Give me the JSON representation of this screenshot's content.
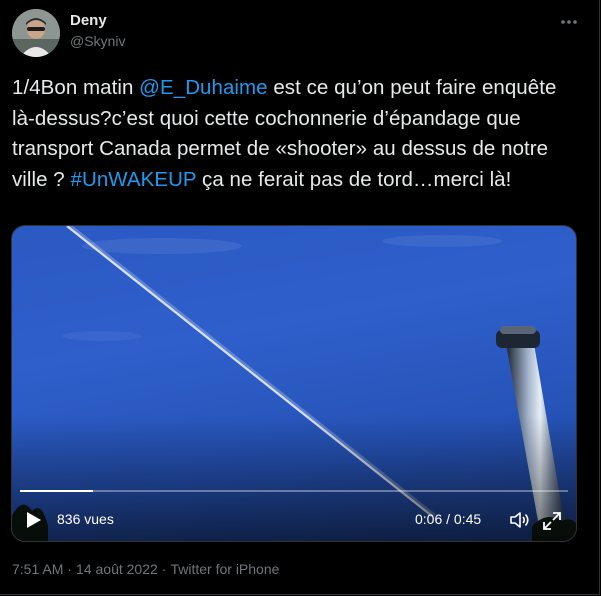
{
  "author": {
    "name": "Deny",
    "handle": "@Skyniv"
  },
  "tweet": {
    "text_parts": [
      {
        "text": "1/4Bon matin ",
        "type": "text"
      },
      {
        "text": "@E_Duhaime",
        "type": "mention"
      },
      {
        "text": " est ce qu’on peut faire enquête là-dessus?c’est quoi cette cochonnerie d’épandage que transport Canada permet de «shooter» au dessus de notre ville ? ",
        "type": "text"
      },
      {
        "text": "#UnWAKEUP",
        "type": "hashtag"
      },
      {
        "text": " ça ne ferait pas de tord…merci là!",
        "type": "text"
      }
    ]
  },
  "video": {
    "views": "836 vues",
    "time": "0:06 / 0:45",
    "progress": 0.133
  },
  "meta": {
    "time": "7:51 AM",
    "separator1": "·",
    "date": "14 août 2022",
    "separator2": "·",
    "source": "Twitter for iPhone"
  },
  "colors": {
    "background": "#000000",
    "text": "#e7e9ea",
    "muted": "#71767b",
    "link": "#1d9bf0",
    "border": "#2f3336"
  },
  "icons": {
    "more": "more-horizontal-icon",
    "play": "play-icon",
    "volume": "volume-icon",
    "fullscreen": "fullscreen-icon"
  }
}
